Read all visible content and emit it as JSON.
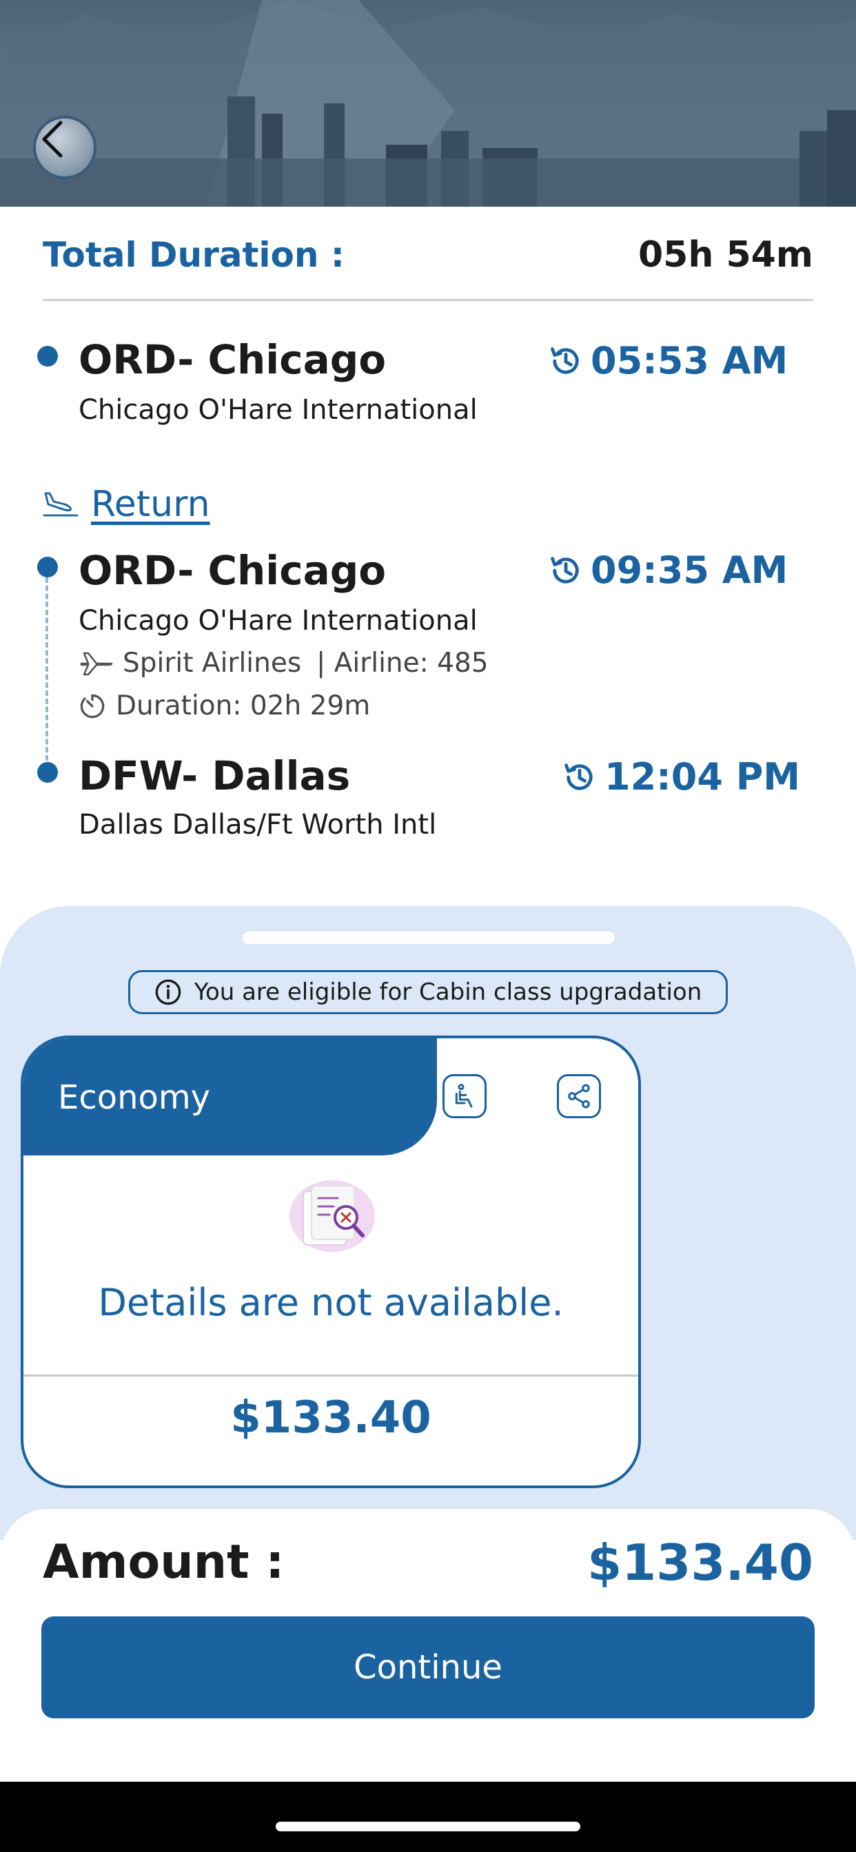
{
  "header": {
    "back_icon": "chevron-left-icon"
  },
  "summary": {
    "total_duration_label": "Total Duration :",
    "total_duration_value": "05h 54m"
  },
  "outbound_arrival": {
    "city": "ORD- Chicago",
    "airport": "Chicago O'Hare International",
    "time": "05:53 AM",
    "time_icon": "clock-history-icon"
  },
  "return_section": {
    "label": "Return",
    "icon": "plane-landing-icon"
  },
  "return_departure": {
    "city": "ORD- Chicago",
    "airport": "Chicago O'Hare International",
    "time": "09:35 AM",
    "airline": "Spirit Airlines",
    "flight": "| Airline: 485",
    "duration": "Duration: 02h 29m"
  },
  "return_arrival": {
    "city": "DFW- Dallas",
    "airport": "Dallas Dallas/Ft Worth Intl",
    "time": "12:04 PM"
  },
  "upgrade_notice": {
    "text": "You are eligible for Cabin class upgradation",
    "icon": "info-icon"
  },
  "fare_card": {
    "cabin": "Economy",
    "seat_icon": "seat-icon",
    "share_icon": "share-icon",
    "empty_message": "Details are not available.",
    "price": "$133.40"
  },
  "footer": {
    "amount_label": "Amount :",
    "amount_value": "$133.40",
    "continue_label": "Continue"
  },
  "colors": {
    "primary": "#1a63a0",
    "sheet_background": "#dce8f8",
    "text": "#1b1b1b"
  }
}
